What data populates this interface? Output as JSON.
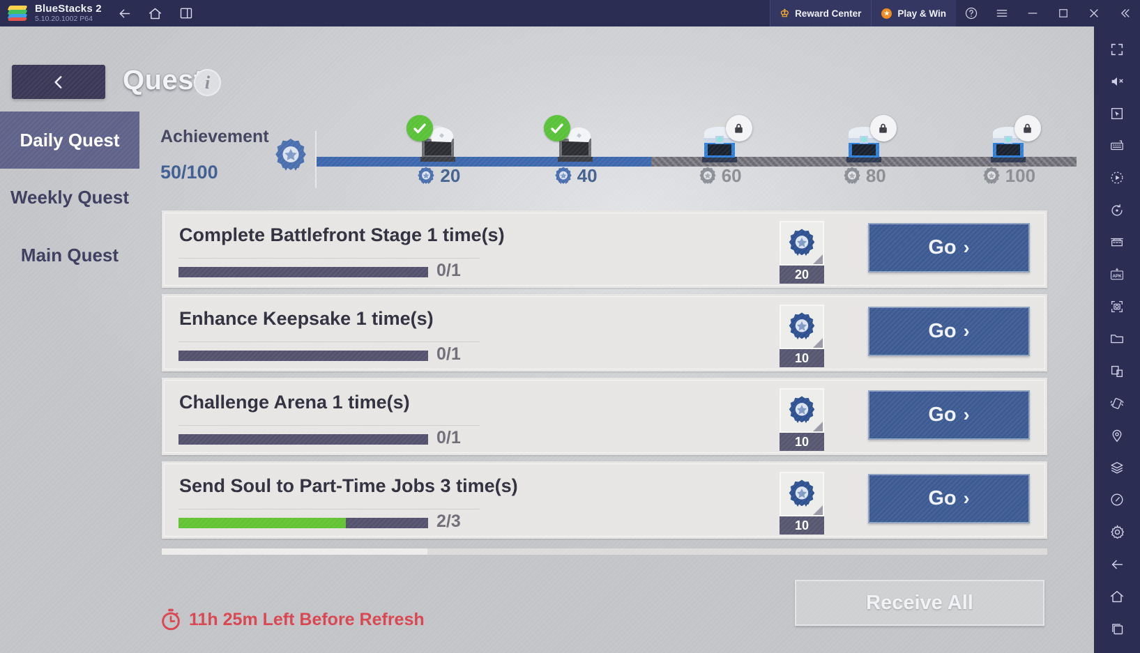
{
  "titlebar": {
    "app_name": "BlueStacks 2",
    "version": "5.10.20.1002  P64",
    "nav_icons": [
      "back-arrow-icon",
      "home-icon",
      "multi-instance-icon"
    ],
    "reward_center": "Reward Center",
    "play_and_win": "Play & Win",
    "sys_icons": [
      "help-icon",
      "menu-icon",
      "minimize-icon",
      "maximize-icon",
      "close-icon",
      "collapse-icon"
    ]
  },
  "right_toolbar": {
    "icons": [
      "fullscreen-icon",
      "mute-icon",
      "cursor-icon",
      "keyboard-controls-icon",
      "macro-record-icon",
      "rotate-icon",
      "multi-instance-manager-icon",
      "install-apk-icon",
      "screenshot-icon",
      "media-folder-icon",
      "copy-icon",
      "shake-icon",
      "location-icon",
      "layers-icon",
      "performance-icon",
      "settings-gear-icon",
      "android-back-icon",
      "android-home-icon",
      "android-recents-icon"
    ]
  },
  "header": {
    "back_button": "back-chevron-icon",
    "title": "Quest",
    "info_badge": "i"
  },
  "nav": {
    "items": [
      {
        "label": "Daily Quest",
        "active": true
      },
      {
        "label": "Weekly Quest",
        "active": false
      },
      {
        "label": "Main Quest",
        "active": false
      }
    ]
  },
  "achievement": {
    "label": "Achievement",
    "value": "50/100",
    "current": 50,
    "max": 100,
    "fill_percent": 44,
    "milestones": [
      {
        "points": "20",
        "position_percent": 16,
        "state": "claimed"
      },
      {
        "points": "40",
        "position_percent": 34,
        "state": "claimed"
      },
      {
        "points": "60",
        "position_percent": 53,
        "state": "locked"
      },
      {
        "points": "80",
        "position_percent": 72,
        "state": "locked"
      },
      {
        "points": "100",
        "position_percent": 91,
        "state": "locked"
      }
    ]
  },
  "quests": [
    {
      "title": "Complete Battlefront Stage 1 time(s)",
      "progress_text": "0/1",
      "progress_percent": 0,
      "reward_points": "20",
      "action": "Go"
    },
    {
      "title": "Enhance Keepsake 1 time(s)",
      "progress_text": "0/1",
      "progress_percent": 0,
      "reward_points": "10",
      "action": "Go"
    },
    {
      "title": "Challenge Arena 1 time(s)",
      "progress_text": "0/1",
      "progress_percent": 0,
      "reward_points": "10",
      "action": "Go"
    },
    {
      "title": "Send Soul to Part-Time Jobs 3 time(s)",
      "progress_text": "2/3",
      "progress_percent": 67,
      "reward_points": "10",
      "action": "Go"
    }
  ],
  "footer": {
    "timer_icon": "stopwatch-icon",
    "timer_text": "11h 25m Left Before Refresh",
    "receive_all": "Receive All"
  },
  "colors": {
    "titlebar_bg": "#2b2d52",
    "accent_blue": "#3d68ae",
    "button_blue": "#3d5b92",
    "progress_green": "#63c332",
    "timer_red": "#d9444e",
    "nav_active": "#5f6289"
  }
}
